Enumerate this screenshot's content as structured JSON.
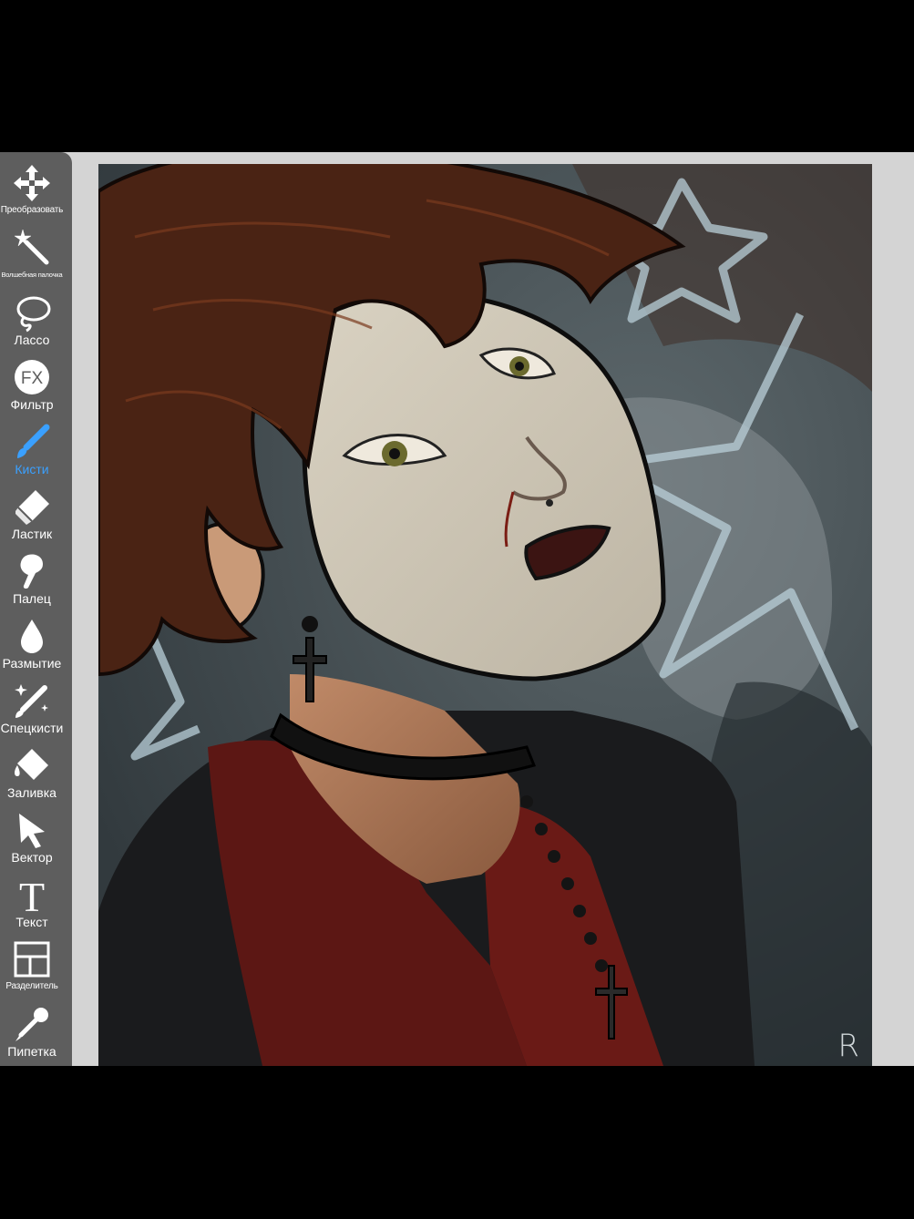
{
  "app": {
    "accent": "#3aa0ff",
    "toolbar_bg": "#5e5e5e",
    "workspace_bg": "#d4d4d4"
  },
  "toolbar": {
    "tools": [
      {
        "label": "Преобразовать",
        "icon": "move-arrows-icon",
        "active": false
      },
      {
        "label": "Волшебная палочка",
        "icon": "magic-wand-icon",
        "active": false
      },
      {
        "label": "Лассо",
        "icon": "lasso-icon",
        "active": false
      },
      {
        "label": "Фильтр",
        "icon": "fx-filter-icon",
        "active": false
      },
      {
        "label": "Кисти",
        "icon": "brush-icon",
        "active": true
      },
      {
        "label": "Ластик",
        "icon": "eraser-icon",
        "active": false
      },
      {
        "label": "Палец",
        "icon": "smudge-finger-icon",
        "active": false
      },
      {
        "label": "Размытие",
        "icon": "blur-drop-icon",
        "active": false
      },
      {
        "label": "Спецкисти",
        "icon": "special-brush-icon",
        "active": false
      },
      {
        "label": "Заливка",
        "icon": "fill-bucket-icon",
        "active": false
      },
      {
        "label": "Вектор",
        "icon": "vector-cursor-icon",
        "active": false
      },
      {
        "label": "Текст",
        "icon": "text-t-icon",
        "active": false
      },
      {
        "label": "Разделитель",
        "icon": "frame-divider-icon",
        "active": false
      },
      {
        "label": "Пипетка",
        "icon": "eyedropper-icon",
        "active": false
      }
    ]
  },
  "canvas": {
    "signature": "R"
  }
}
